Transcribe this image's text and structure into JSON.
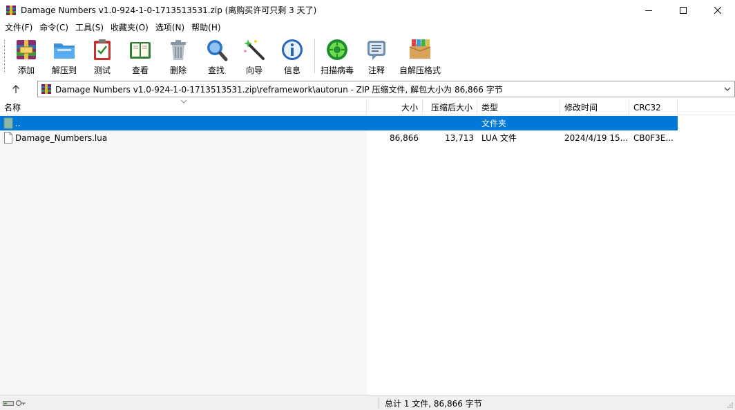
{
  "window": {
    "title": "Damage Numbers v1.0-924-1-0-1713513531.zip (离购买许可只剩 3 天了)"
  },
  "menu": [
    "文件(F)",
    "命令(C)",
    "工具(S)",
    "收藏夹(O)",
    "选项(N)",
    "帮助(H)"
  ],
  "toolbar": [
    {
      "label": "添加",
      "icon": "add-archive-icon"
    },
    {
      "label": "解压到",
      "icon": "extract-folder-icon"
    },
    {
      "label": "测试",
      "icon": "test-clipboard-icon"
    },
    {
      "label": "查看",
      "icon": "view-book-icon"
    },
    {
      "label": "删除",
      "icon": "trash-icon"
    },
    {
      "label": "查找",
      "icon": "magnifier-icon"
    },
    {
      "label": "向导",
      "icon": "wizard-wand-icon"
    },
    {
      "label": "信息",
      "icon": "info-icon"
    },
    {
      "label": "扫描病毒",
      "icon": "virus-scan-icon"
    },
    {
      "label": "注释",
      "icon": "comment-icon"
    },
    {
      "label": "自解压格式",
      "icon": "sfx-box-icon"
    }
  ],
  "address": {
    "path": "Damage Numbers v1.0-924-1-0-1713513531.zip\\reframework\\autorun - ZIP 压缩文件, 解包大小为 86,866 字节"
  },
  "columns": {
    "name": "名称",
    "size": "大小",
    "packed": "压缩后大小",
    "type": "类型",
    "modified": "修改时间",
    "crc": "CRC32"
  },
  "rows": [
    {
      "name": "..",
      "size": "",
      "packed": "",
      "type": "文件夹",
      "modified": "",
      "crc": "",
      "selected": true
    },
    {
      "name": "Damage_Numbers.lua",
      "size": "86,866",
      "packed": "13,713",
      "type": "LUA 文件",
      "modified": "2024/4/19 15...",
      "crc": "CB0F3E...",
      "selected": false
    }
  ],
  "status": {
    "summary": "总计 1 文件, 86,866 字节"
  },
  "colors": {
    "selection": "#0078d7",
    "toolbar_separator": "#d0d0d0"
  }
}
